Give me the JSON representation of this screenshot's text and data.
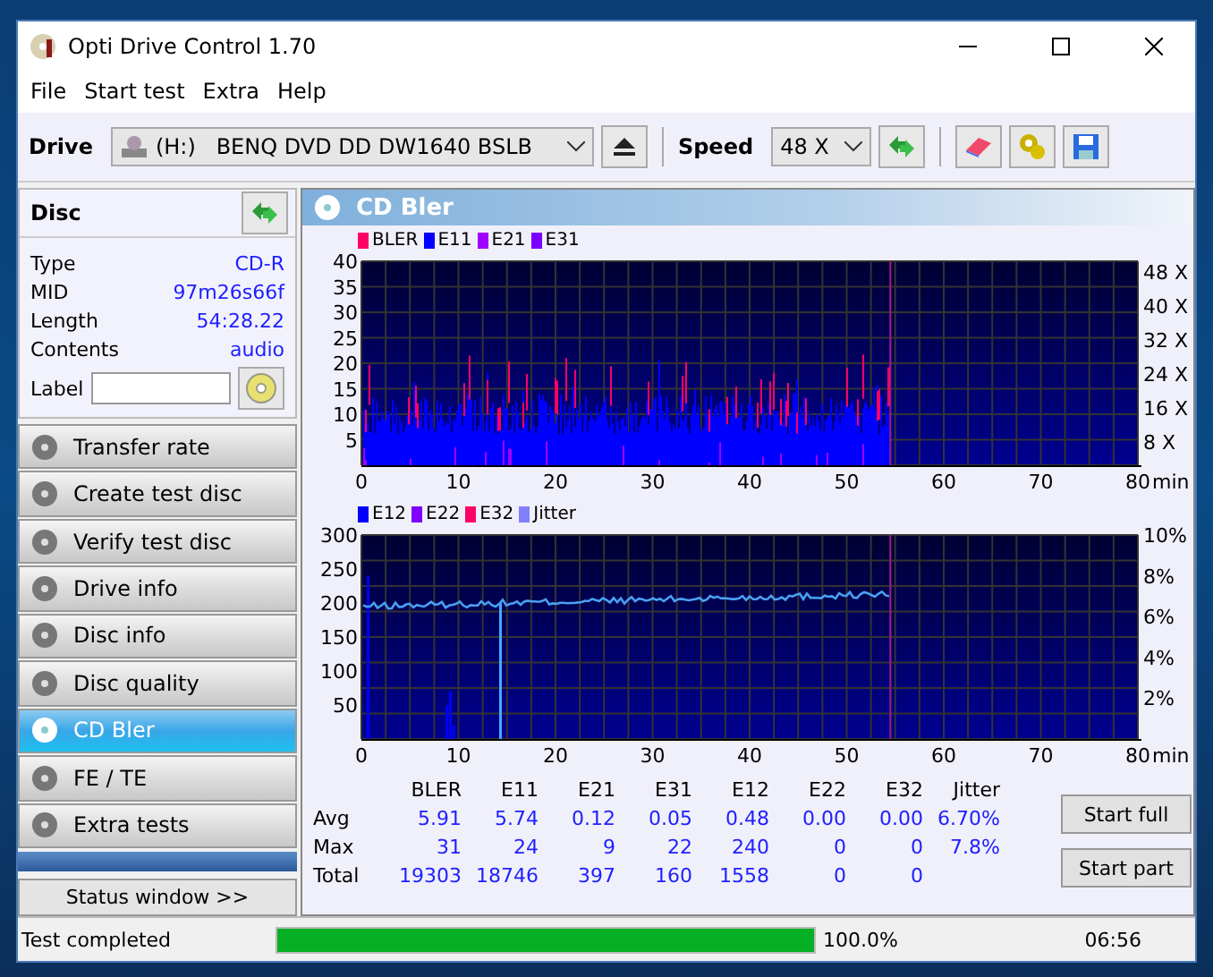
{
  "window": {
    "title": "Opti Drive Control 1.70"
  },
  "menu": [
    "File",
    "Start test",
    "Extra",
    "Help"
  ],
  "toolbar": {
    "drive_label": "Drive",
    "drive": "(H:)   BENQ DVD DD DW1640 BSLB",
    "speed_label": "Speed",
    "speed": "48 X"
  },
  "disc": {
    "title": "Disc",
    "fields": [
      {
        "label": "Type",
        "value": "CD-R"
      },
      {
        "label": "MID",
        "value": "97m26s66f"
      },
      {
        "label": "Length",
        "value": "54:28.22"
      },
      {
        "label": "Contents",
        "value": "audio"
      }
    ],
    "label_field": {
      "label": "Label"
    }
  },
  "nav": [
    {
      "label": "Transfer rate",
      "selected": false
    },
    {
      "label": "Create test disc",
      "selected": false
    },
    {
      "label": "Verify test disc",
      "selected": false
    },
    {
      "label": "Drive info",
      "selected": false
    },
    {
      "label": "Disc info",
      "selected": false
    },
    {
      "label": "Disc quality",
      "selected": false
    },
    {
      "label": "CD Bler",
      "selected": true
    },
    {
      "label": "FE / TE",
      "selected": false
    },
    {
      "label": "Extra tests",
      "selected": false
    }
  ],
  "status_window_button": "Status window >>",
  "panel": {
    "title": "CD Bler"
  },
  "charts": [
    {
      "kind": "bler",
      "legend": [
        {
          "name": "BLER",
          "color": "#ff0066"
        },
        {
          "name": "E11",
          "color": "#0000ff"
        },
        {
          "name": "E21",
          "color": "#a000ff"
        },
        {
          "name": "E31",
          "color": "#7a00ff"
        }
      ],
      "y_ticks": [
        "40",
        "35",
        "30",
        "25",
        "20",
        "15",
        "10",
        "5"
      ],
      "y2_ticks": [
        "48 X",
        "40 X",
        "32 X",
        "24 X",
        "16 X",
        "8 X"
      ],
      "x_ticks": [
        "0",
        "10",
        "20",
        "30",
        "40",
        "50",
        "60",
        "70",
        "80"
      ],
      "x_unit": "min"
    },
    {
      "kind": "jitter",
      "legend": [
        {
          "name": "E12",
          "color": "#0000ff"
        },
        {
          "name": "E22",
          "color": "#8000ff"
        },
        {
          "name": "E32",
          "color": "#ff0066"
        },
        {
          "name": "Jitter",
          "color": "#8080ff"
        }
      ],
      "y_ticks": [
        "300",
        "250",
        "200",
        "150",
        "100",
        "50"
      ],
      "y2_ticks": [
        "10%",
        "8%",
        "6%",
        "4%",
        "2%"
      ],
      "x_ticks": [
        "0",
        "10",
        "20",
        "30",
        "40",
        "50",
        "60",
        "70",
        "80"
      ],
      "x_unit": "min"
    }
  ],
  "stats": {
    "columns": [
      "BLER",
      "E11",
      "E21",
      "E31",
      "E12",
      "E22",
      "E32",
      "Jitter"
    ],
    "rows": [
      {
        "label": "Avg",
        "values": [
          "5.91",
          "5.74",
          "0.12",
          "0.05",
          "0.48",
          "0.00",
          "0.00",
          "6.70%"
        ]
      },
      {
        "label": "Max",
        "values": [
          "31",
          "24",
          "9",
          "22",
          "240",
          "0",
          "0",
          "7.8%"
        ]
      },
      {
        "label": "Total",
        "values": [
          "19303",
          "18746",
          "397",
          "160",
          "1558",
          "0",
          "0"
        ]
      }
    ]
  },
  "buttons": [
    "Start full",
    "Start part"
  ],
  "status_bar": {
    "message": "Test completed",
    "progress": {
      "level": 1
    },
    "percent": "100.0%",
    "time": "06:56"
  }
}
